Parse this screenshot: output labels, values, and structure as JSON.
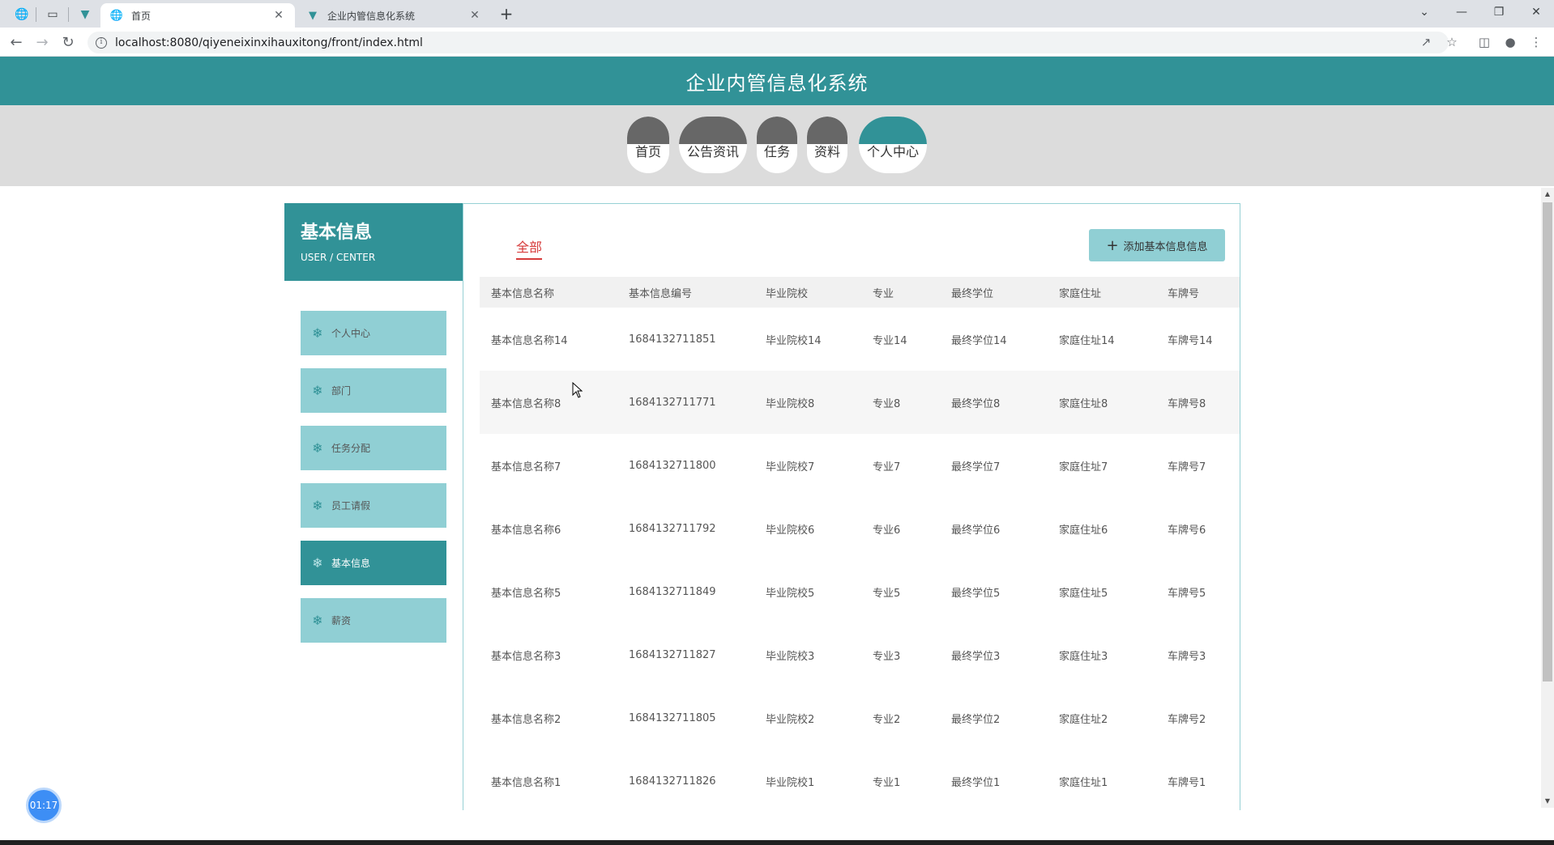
{
  "browser": {
    "tabs": [
      {
        "title": "首页",
        "active": true
      },
      {
        "title": "企业内管信息化系统",
        "active": false
      }
    ],
    "url": "localhost:8080/qiyeneixinxihauxitong/front/index.html",
    "new_tab_icon": "plus-icon"
  },
  "site": {
    "title": "企业内管信息化系统",
    "nav": [
      "首页",
      "公告资讯",
      "任务",
      "资料",
      "个人中心"
    ],
    "nav_active": "个人中心"
  },
  "sidebar": {
    "title": "基本信息",
    "subtitle": "USER / CENTER",
    "items": [
      {
        "label": "个人中心",
        "active": false
      },
      {
        "label": "部门",
        "active": false
      },
      {
        "label": "任务分配",
        "active": false
      },
      {
        "label": "员工请假",
        "active": false
      },
      {
        "label": "基本信息",
        "active": true
      },
      {
        "label": "薪资",
        "active": false
      }
    ]
  },
  "main": {
    "filter_tab": "全部",
    "add_button": "添加基本信息信息",
    "table": {
      "columns": [
        "基本信息名称",
        "基本信息编号",
        "毕业院校",
        "专业",
        "最终学位",
        "家庭住址",
        "车牌号"
      ],
      "rows": [
        [
          "基本信息名称14",
          "1684132711851",
          "毕业院校14",
          "专业14",
          "最终学位14",
          "家庭住址14",
          "车牌号14"
        ],
        [
          "基本信息名称8",
          "1684132711771",
          "毕业院校8",
          "专业8",
          "最终学位8",
          "家庭住址8",
          "车牌号8"
        ],
        [
          "基本信息名称7",
          "1684132711800",
          "毕业院校7",
          "专业7",
          "最终学位7",
          "家庭住址7",
          "车牌号7"
        ],
        [
          "基本信息名称6",
          "1684132711792",
          "毕业院校6",
          "专业6",
          "最终学位6",
          "家庭住址6",
          "车牌号6"
        ],
        [
          "基本信息名称5",
          "1684132711849",
          "毕业院校5",
          "专业5",
          "最终学位5",
          "家庭住址5",
          "车牌号5"
        ],
        [
          "基本信息名称3",
          "1684132711827",
          "毕业院校3",
          "专业3",
          "最终学位3",
          "家庭住址3",
          "车牌号3"
        ],
        [
          "基本信息名称2",
          "1684132711805",
          "毕业院校2",
          "专业2",
          "最终学位2",
          "家庭住址2",
          "车牌号2"
        ],
        [
          "基本信息名称1",
          "1684132711826",
          "毕业院校1",
          "专业1",
          "最终学位1",
          "家庭住址1",
          "车牌号1"
        ]
      ]
    }
  },
  "timer": "01:17",
  "colors": {
    "primary": "#319297",
    "light": "#90cfd4",
    "accent_red": "#d63a3a",
    "nav_dark": "#676767"
  }
}
